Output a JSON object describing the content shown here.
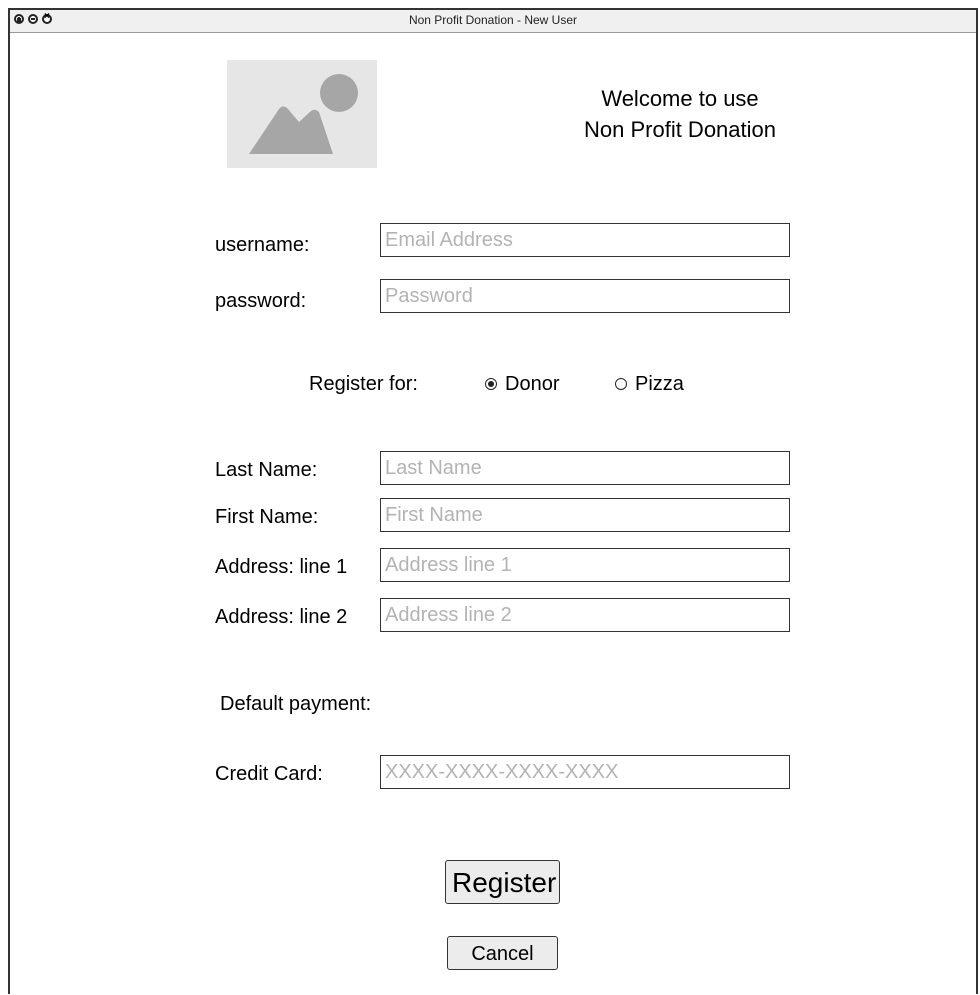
{
  "window": {
    "title": "Non Profit Donation - New User"
  },
  "welcome": {
    "line1": "Welcome to use",
    "line2": "Non Profit Donation"
  },
  "login": {
    "username_label": "username:",
    "username_placeholder": "Email Address",
    "password_label": "password:",
    "password_placeholder": "Password"
  },
  "register_for": {
    "label": "Register for:",
    "options": [
      {
        "label": "Donor",
        "selected": true
      },
      {
        "label": "Pizza",
        "selected": false
      }
    ]
  },
  "profile": {
    "last_name_label": "Last Name:",
    "last_name_placeholder": "Last Name",
    "first_name_label": "First Name:",
    "first_name_placeholder": "First Name",
    "address1_label": "Address: line 1",
    "address1_placeholder": "Address line 1",
    "address2_label": "Address: line 2",
    "address2_placeholder": "Address line 2"
  },
  "payment": {
    "heading": "Default payment:",
    "credit_card_label": "Credit Card:",
    "credit_card_placeholder": "XXXX-XXXX-XXXX-XXXX"
  },
  "actions": {
    "register_label": "Register",
    "cancel_label": "Cancel"
  }
}
